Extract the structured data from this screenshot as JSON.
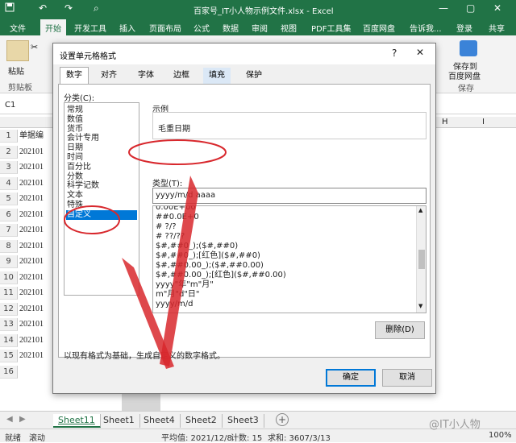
{
  "window": {
    "title": "百家号_IT小人物示例文件.xlsx - Excel",
    "quick_access": [
      "save-icon",
      "undo-icon",
      "redo-icon",
      "print-preview-icon"
    ]
  },
  "ribbon": {
    "tabs": [
      "文件",
      "开始",
      "开发工具",
      "插入",
      "页面布局",
      "公式",
      "数据",
      "审阅",
      "视图",
      "PDF工具集",
      "百度网盘"
    ],
    "active_tab": "开始",
    "tell_me": "告诉我...",
    "login": "登录",
    "share": "共享",
    "paste_label": "粘贴",
    "clipboard_label": "剪贴板",
    "save_to_label": "保存到",
    "save_to_label2": "百度网盘",
    "save_group_label": "保存"
  },
  "formula_bar": {
    "name_box": "C1"
  },
  "grid": {
    "col_header_B": "",
    "col_header_H": "H",
    "col_header_I": "I",
    "row_numbers": [
      "1",
      "2",
      "3",
      "4",
      "5",
      "6",
      "7",
      "8",
      "9",
      "10",
      "11",
      "12",
      "13",
      "14",
      "15",
      "16"
    ],
    "cells": [
      "单据编",
      "202101",
      "202101",
      "202101",
      "202101",
      "202101",
      "202101",
      "202101",
      "202101",
      "202101",
      "202101",
      "202101",
      "202101",
      "202101",
      "202101"
    ]
  },
  "sheet_tabs": {
    "tabs": [
      "Sheet11",
      "Sheet1",
      "Sheet4",
      "Sheet2",
      "Sheet3"
    ],
    "active": "Sheet11"
  },
  "status_bar": {
    "mode": "就绪",
    "scroll": "滚动",
    "average": "平均值: 2021/12/8",
    "count": "计数: 15",
    "sum": "求和: 3607/3/13",
    "zoom": "100%"
  },
  "dialog": {
    "title": "设置单元格格式",
    "tabs": [
      "数字",
      "对齐",
      "字体",
      "边框",
      "填充",
      "保护"
    ],
    "active_tab": "数字",
    "category_label": "分类(C):",
    "categories": [
      "常规",
      "数值",
      "货币",
      "会计专用",
      "日期",
      "时间",
      "百分比",
      "分数",
      "科学记数",
      "文本",
      "特殊",
      "自定义"
    ],
    "selected_category": "自定义",
    "sample_label": "示例",
    "sample_value": "毛重日期",
    "type_label": "类型(T):",
    "type_value": "yyyy/m/d aaaa",
    "formats": [
      "0.00E+00",
      "##0.0E+0",
      "# ?/?",
      "# ??/??",
      "$#,##0_);($#,##0)",
      "$#,##0_);[红色]($#,##0)",
      "$#,##0.00_);($#,##0.00)",
      "$#,##0.00_);[红色]($#,##0.00)",
      "yyyy\"年\"m\"月\"",
      "m\"月\"d\"日\"",
      "yyyy/m/d"
    ],
    "delete_button": "删除(D)",
    "description": "以现有格式为基础，生成自定义的数字格式。",
    "ok_button": "确定",
    "cancel_button": "取消"
  },
  "watermark": "@IT小人物",
  "colors": {
    "excel_green": "#217346",
    "annotation_red": "#d8282d",
    "selection_blue": "#0078d7"
  }
}
